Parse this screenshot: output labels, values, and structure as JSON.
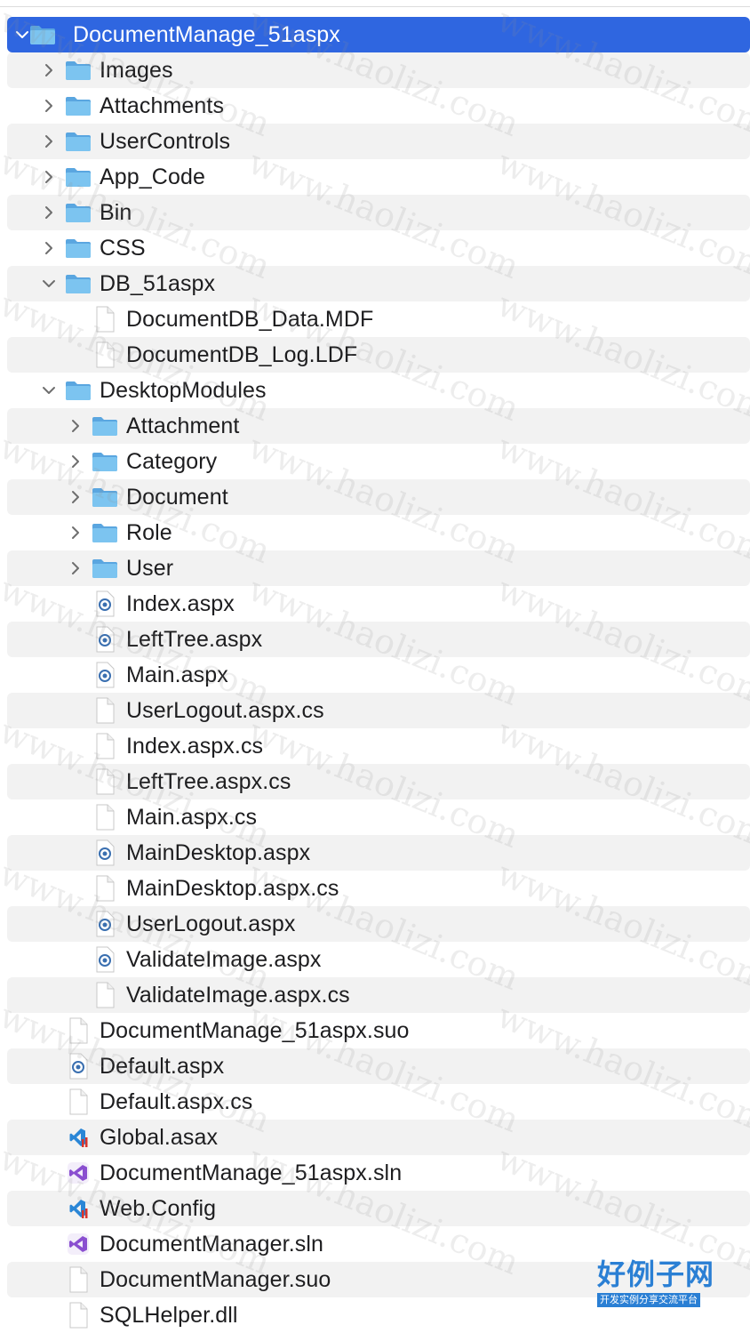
{
  "items": [
    {
      "label": "DocumentManage_51aspx",
      "depth": 0,
      "kind": "folder",
      "state": "expanded",
      "selected": true
    },
    {
      "label": "Images",
      "depth": 1,
      "kind": "folder",
      "state": "collapsed"
    },
    {
      "label": "Attachments",
      "depth": 1,
      "kind": "folder",
      "state": "collapsed"
    },
    {
      "label": "UserControls",
      "depth": 1,
      "kind": "folder",
      "state": "collapsed"
    },
    {
      "label": "App_Code",
      "depth": 1,
      "kind": "folder",
      "state": "collapsed"
    },
    {
      "label": "Bin",
      "depth": 1,
      "kind": "folder",
      "state": "collapsed"
    },
    {
      "label": "CSS",
      "depth": 1,
      "kind": "folder",
      "state": "collapsed"
    },
    {
      "label": "DB_51aspx",
      "depth": 1,
      "kind": "folder",
      "state": "expanded"
    },
    {
      "label": "DocumentDB_Data.MDF",
      "depth": 2,
      "kind": "file"
    },
    {
      "label": "DocumentDB_Log.LDF",
      "depth": 2,
      "kind": "file"
    },
    {
      "label": "DesktopModules",
      "depth": 1,
      "kind": "folder",
      "state": "expanded"
    },
    {
      "label": "Attachment",
      "depth": 2,
      "kind": "folder",
      "state": "collapsed"
    },
    {
      "label": "Category",
      "depth": 2,
      "kind": "folder",
      "state": "collapsed"
    },
    {
      "label": "Document",
      "depth": 2,
      "kind": "folder",
      "state": "collapsed"
    },
    {
      "label": "Role",
      "depth": 2,
      "kind": "folder",
      "state": "collapsed"
    },
    {
      "label": "User",
      "depth": 2,
      "kind": "folder",
      "state": "collapsed"
    },
    {
      "label": "Index.aspx",
      "depth": 2,
      "kind": "aspx"
    },
    {
      "label": "LeftTree.aspx",
      "depth": 2,
      "kind": "aspx"
    },
    {
      "label": "Main.aspx",
      "depth": 2,
      "kind": "aspx"
    },
    {
      "label": "UserLogout.aspx.cs",
      "depth": 2,
      "kind": "file"
    },
    {
      "label": "Index.aspx.cs",
      "depth": 2,
      "kind": "file"
    },
    {
      "label": "LeftTree.aspx.cs",
      "depth": 2,
      "kind": "file"
    },
    {
      "label": "Main.aspx.cs",
      "depth": 2,
      "kind": "file"
    },
    {
      "label": "MainDesktop.aspx",
      "depth": 2,
      "kind": "aspx"
    },
    {
      "label": "MainDesktop.aspx.cs",
      "depth": 2,
      "kind": "file"
    },
    {
      "label": "UserLogout.aspx",
      "depth": 2,
      "kind": "aspx"
    },
    {
      "label": "ValidateImage.aspx",
      "depth": 2,
      "kind": "aspx"
    },
    {
      "label": "ValidateImage.aspx.cs",
      "depth": 2,
      "kind": "file"
    },
    {
      "label": "DocumentManage_51aspx.suo",
      "depth": 1,
      "kind": "file"
    },
    {
      "label": "Default.aspx",
      "depth": 1,
      "kind": "aspx"
    },
    {
      "label": "Default.aspx.cs",
      "depth": 1,
      "kind": "file"
    },
    {
      "label": "Global.asax",
      "depth": 1,
      "kind": "vscode"
    },
    {
      "label": "DocumentManage_51aspx.sln",
      "depth": 1,
      "kind": "vs"
    },
    {
      "label": "Web.Config",
      "depth": 1,
      "kind": "vscode"
    },
    {
      "label": "DocumentManager.sln",
      "depth": 1,
      "kind": "vs"
    },
    {
      "label": "DocumentManager.suo",
      "depth": 1,
      "kind": "file"
    },
    {
      "label": "SQLHelper.dll",
      "depth": 1,
      "kind": "file"
    }
  ],
  "watermark": "www.haolizi.com",
  "logo": {
    "title": "好例子网",
    "subtitle": "开发实例分享交流平台"
  },
  "colors": {
    "selection": "#2f66e0",
    "folder": "#6fb8ea",
    "stripe": "#f2f2f2"
  }
}
